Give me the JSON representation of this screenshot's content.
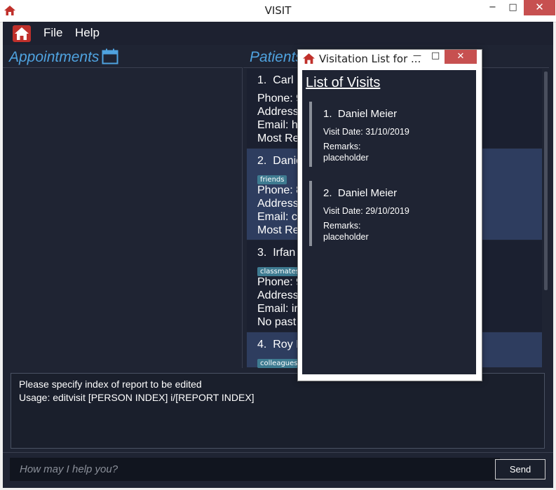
{
  "window": {
    "title": "VISIT",
    "minimize": "−",
    "maximize": "□",
    "close": "✕"
  },
  "menu": {
    "file": "File",
    "help": "Help"
  },
  "sections": {
    "appointments": "Appointments",
    "patients": "Patients"
  },
  "patients": [
    {
      "index": "1.",
      "name": "Carl",
      "tag": "",
      "phone": "Phone: 95",
      "address": "Address: w",
      "email": "Email: hei",
      "recent": "Most Rece"
    },
    {
      "index": "2.",
      "name": "Danie",
      "tag": "friends",
      "phone": "Phone: 87",
      "address": "Address: ",
      "email": "Email: cor",
      "recent": "Most Rece"
    },
    {
      "index": "3.",
      "name": "Irfan",
      "tag": "classmates",
      "phone": "Phone: 92",
      "address": "Address: I",
      "email": "Email: irfa",
      "recent": "No past r"
    },
    {
      "index": "4.",
      "name": "Roy I",
      "tag": "colleagues"
    }
  ],
  "result": {
    "line1": "Please specify index of report to be edited",
    "line2": "Usage: editvisit [PERSON INDEX] i/[REPORT INDEX]"
  },
  "command": {
    "prompt": ">",
    "placeholder": "How may I help you?",
    "send": "Send"
  },
  "popup": {
    "title": "Visitation List for ...",
    "minimize": "—",
    "maximize": "□",
    "close": "✕",
    "heading": "List of Visits",
    "visits": [
      {
        "index": "1.",
        "name": "Daniel Meier",
        "date": "Visit Date: 31/10/2019",
        "remarks_label": "Remarks:",
        "remarks": "placeholder"
      },
      {
        "index": "2.",
        "name": "Daniel Meier",
        "date": "Visit Date: 29/10/2019",
        "remarks_label": "Remarks:",
        "remarks": "placeholder"
      }
    ]
  },
  "colors": {
    "accent": "#4fa3e0",
    "background": "#1f2433",
    "selected_row": "#2e3d5f",
    "tag": "#3e7b91",
    "close_button": "#c75050"
  },
  "icons": {
    "app": "home-icon",
    "calendar": "calendar-icon"
  }
}
